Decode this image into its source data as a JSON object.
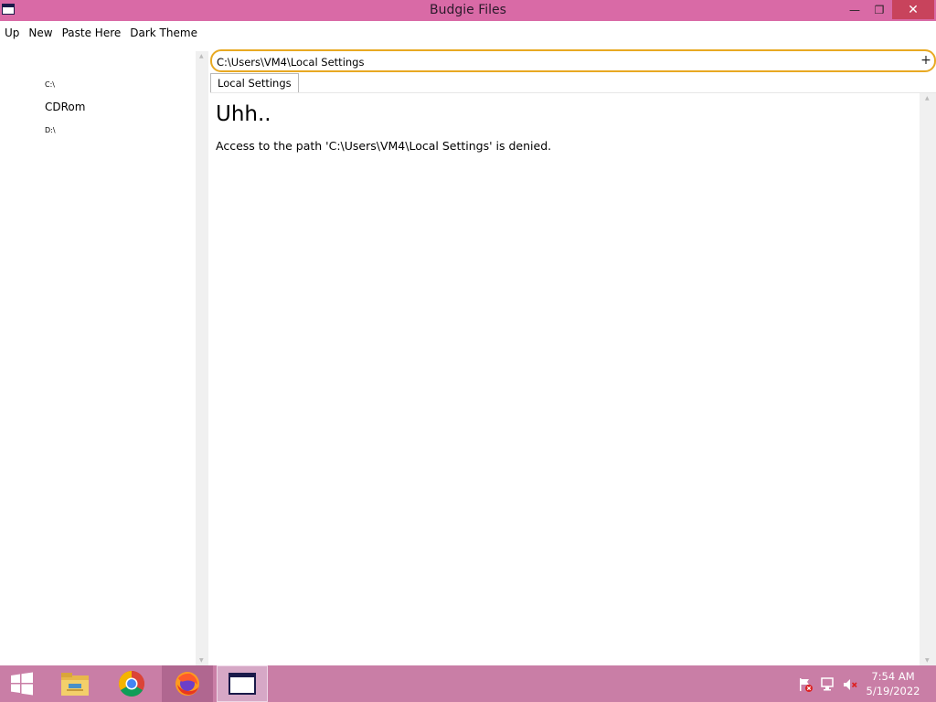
{
  "window": {
    "title": "Budgie Files",
    "controls": {
      "minimize": "—",
      "maximize": "❐",
      "close": "✕"
    }
  },
  "menu": {
    "items": [
      {
        "label": "Up"
      },
      {
        "label": "New"
      },
      {
        "label": "Paste Here"
      },
      {
        "label": "Dark Theme"
      }
    ]
  },
  "sidebar": {
    "drives": [
      {
        "label": "C:\\"
      },
      {
        "label": "CDRom"
      },
      {
        "label": "D:\\"
      }
    ]
  },
  "pathbar": {
    "value": "C:\\Users\\VM4\\Local Settings",
    "add_label": "+"
  },
  "tabs": [
    {
      "label": "Local Settings"
    }
  ],
  "content": {
    "heading": "Uhh..",
    "message": "Access to the path 'C:\\Users\\VM4\\Local Settings' is denied."
  },
  "taskbar": {
    "apps": [
      "windows-start-icon",
      "file-explorer-icon",
      "chrome-icon",
      "firefox-icon",
      "budgie-files-icon"
    ],
    "tray": [
      "action-center-flag-icon",
      "network-icon",
      "volume-muted-icon"
    ],
    "time": "7:54 AM",
    "date": "5/19/2022"
  },
  "colors": {
    "titlebar": "#d96aa6",
    "close_button": "#c8435c",
    "path_border": "#e8a922",
    "taskbar": "#c97ea6"
  }
}
